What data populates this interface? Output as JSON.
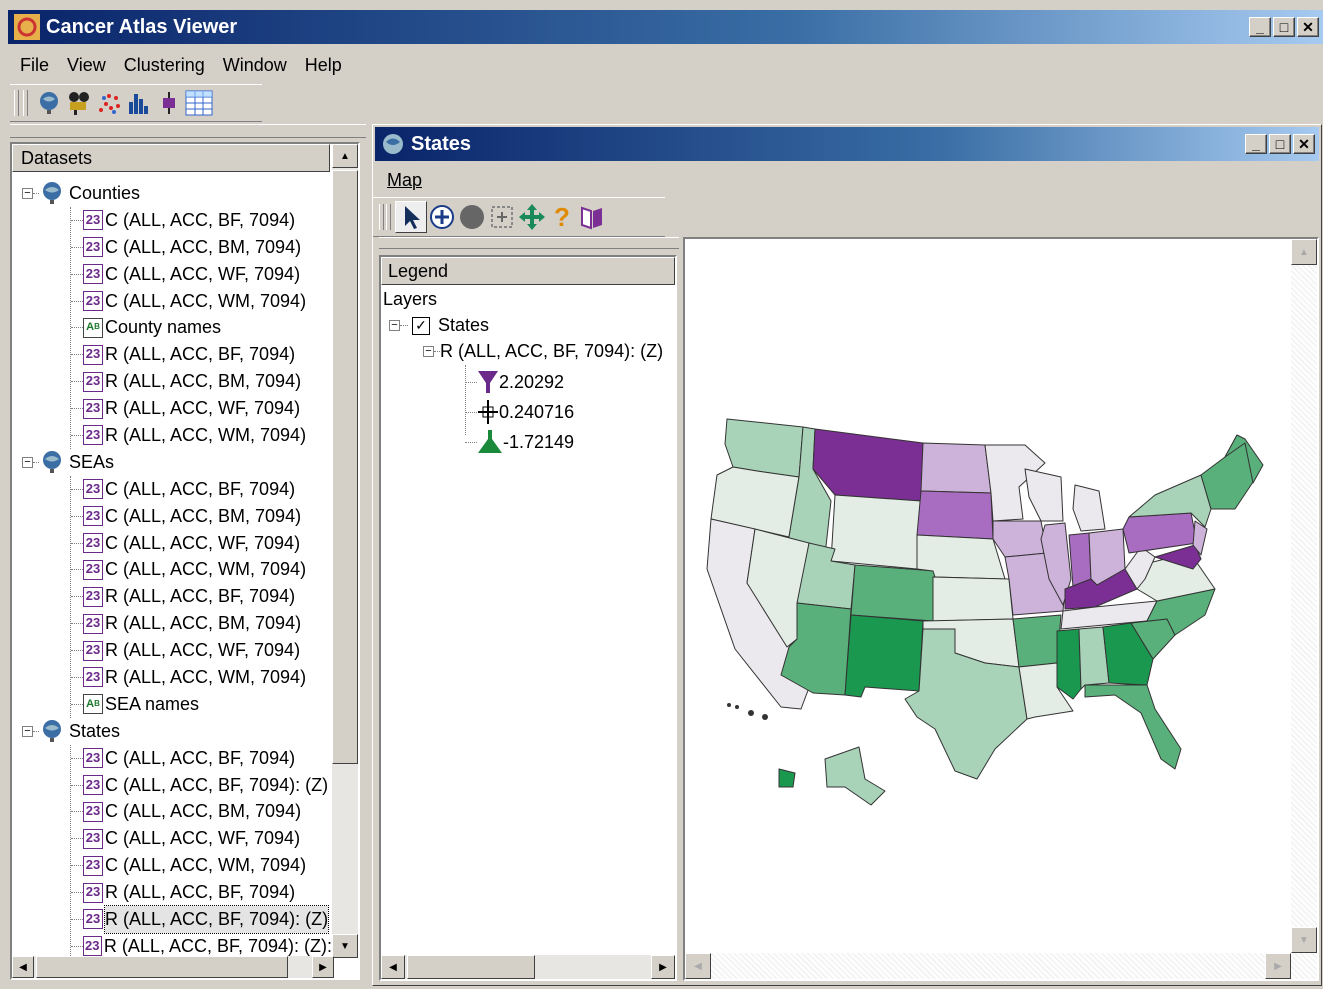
{
  "app": {
    "title": "Cancer Atlas Viewer"
  },
  "menu": {
    "file": "File",
    "view": "View",
    "clustering": "Clustering",
    "window": "Window",
    "help": "Help"
  },
  "toolbar": {
    "icons": [
      "globe-icon",
      "camera-icon",
      "scatter-icon",
      "histogram-icon",
      "boxplot-icon",
      "table-icon"
    ]
  },
  "datasets": {
    "header": "Datasets",
    "groups": [
      {
        "label": "Counties",
        "items": [
          {
            "icon": "numeric",
            "label": "C (ALL, ACC, BF, 7094)"
          },
          {
            "icon": "numeric",
            "label": "C (ALL, ACC, BM, 7094)"
          },
          {
            "icon": "numeric",
            "label": "C (ALL, ACC, WF, 7094)"
          },
          {
            "icon": "numeric",
            "label": "C (ALL, ACC, WM, 7094)"
          },
          {
            "icon": "text",
            "label": "County names"
          },
          {
            "icon": "numeric",
            "label": "R (ALL, ACC, BF, 7094)"
          },
          {
            "icon": "numeric",
            "label": "R (ALL, ACC, BM, 7094)"
          },
          {
            "icon": "numeric",
            "label": "R (ALL, ACC, WF, 7094)"
          },
          {
            "icon": "numeric",
            "label": "R (ALL, ACC, WM, 7094)"
          }
        ]
      },
      {
        "label": "SEAs",
        "items": [
          {
            "icon": "numeric",
            "label": "C (ALL, ACC, BF, 7094)"
          },
          {
            "icon": "numeric",
            "label": "C (ALL, ACC, BM, 7094)"
          },
          {
            "icon": "numeric",
            "label": "C (ALL, ACC, WF, 7094)"
          },
          {
            "icon": "numeric",
            "label": "C (ALL, ACC, WM, 7094)"
          },
          {
            "icon": "numeric",
            "label": "R (ALL, ACC, BF, 7094)"
          },
          {
            "icon": "numeric",
            "label": "R (ALL, ACC, BM, 7094)"
          },
          {
            "icon": "numeric",
            "label": "R (ALL, ACC, WF, 7094)"
          },
          {
            "icon": "numeric",
            "label": "R (ALL, ACC, WM, 7094)"
          },
          {
            "icon": "text",
            "label": "SEA names"
          }
        ]
      },
      {
        "label": "States",
        "items": [
          {
            "icon": "numeric",
            "label": "C (ALL, ACC, BF, 7094)"
          },
          {
            "icon": "numeric",
            "label": "C (ALL, ACC, BF, 7094): (Z)"
          },
          {
            "icon": "numeric",
            "label": "C (ALL, ACC, BM, 7094)"
          },
          {
            "icon": "numeric",
            "label": "C (ALL, ACC, WF, 7094)"
          },
          {
            "icon": "numeric",
            "label": "C (ALL, ACC, WM, 7094)"
          },
          {
            "icon": "numeric",
            "label": "R (ALL, ACC, BF, 7094)"
          },
          {
            "icon": "numeric",
            "label": "R (ALL, ACC, BF, 7094): (Z)",
            "selected": true
          },
          {
            "icon": "numeric",
            "label": "R (ALL, ACC, BF, 7094): (Z):"
          }
        ]
      }
    ]
  },
  "states_window": {
    "title": "States",
    "menu": {
      "map": "Map"
    },
    "toolbar_icons": [
      "pointer-icon",
      "zoom-in-icon",
      "circle-icon",
      "zoom-extent-icon",
      "pan-icon",
      "help-icon",
      "book-icon"
    ],
    "legend": {
      "header": "Legend",
      "layers_label": "Layers",
      "layer": "States",
      "layer_checked": true,
      "variable": "R (ALL, ACC, BF, 7094): (Z)",
      "breaks": [
        {
          "value": "2.20292",
          "color": "#6b2a8a",
          "shape": "down-triangle"
        },
        {
          "value": "0.240716",
          "color": "#000000",
          "shape": "cross"
        },
        {
          "value": "-1.72149",
          "color": "#1a8a3a",
          "shape": "up-triangle"
        }
      ]
    }
  },
  "colors": {
    "purple_dark": "#7b2f95",
    "purple_mid": "#a86cc0",
    "purple_light": "#cdb3d9",
    "neutral": "#ece9ee",
    "green_pale": "#e3ede6",
    "green_light": "#a8d3b8",
    "green_mid": "#59b07a",
    "green_dark": "#1a9850"
  }
}
